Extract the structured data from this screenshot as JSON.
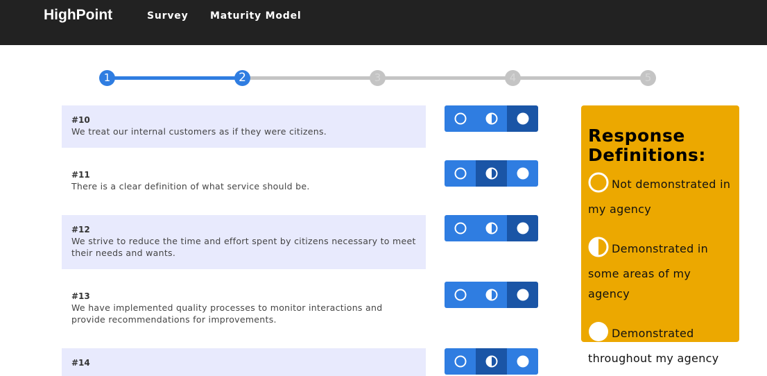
{
  "nav": {
    "brand": "HighPoint",
    "links": [
      "Survey",
      "Maturity Model"
    ]
  },
  "stepper": {
    "steps": [
      "1",
      "2",
      "3",
      "4",
      "5"
    ],
    "current_step": 2
  },
  "questions": [
    {
      "number": "#10",
      "text": "We treat our internal customers as if they were citizens.",
      "selected": "demonstrated_throughout"
    },
    {
      "number": "#11",
      "text": "There is a clear definition of what service should be.",
      "selected": "demonstrated_some_areas"
    },
    {
      "number": "#12",
      "text": "We strive to reduce the time and effort spent by citizens necessary to meet their needs and wants.",
      "selected": "demonstrated_throughout"
    },
    {
      "number": "#13",
      "text": "We have implemented quality processes to monitor interactions and provide recommendations for improvements.",
      "selected": "demonstrated_throughout"
    },
    {
      "number": "#14",
      "text": "",
      "selected": "demonstrated_some_areas"
    }
  ],
  "response_options": [
    "empty-circle-icon",
    "half-circle-icon",
    "full-circle-icon"
  ],
  "definitions": {
    "title": "Response Definitions:",
    "items": [
      {
        "icon": "empty-circle-icon",
        "label": "Not demonstrated in my agency"
      },
      {
        "icon": "half-circle-icon",
        "label": "Demonstrated in some areas of my agency"
      },
      {
        "icon": "full-circle-icon",
        "label": "Demonstrated throughout my agency"
      }
    ]
  },
  "colors": {
    "navbar": "#222222",
    "accent_blue": "#2f7de1",
    "selected_blue": "#1a55a6",
    "card_shade": "#e8eafd",
    "panel_gold": "#eca800",
    "inactive_step": "#c4c4c4"
  }
}
